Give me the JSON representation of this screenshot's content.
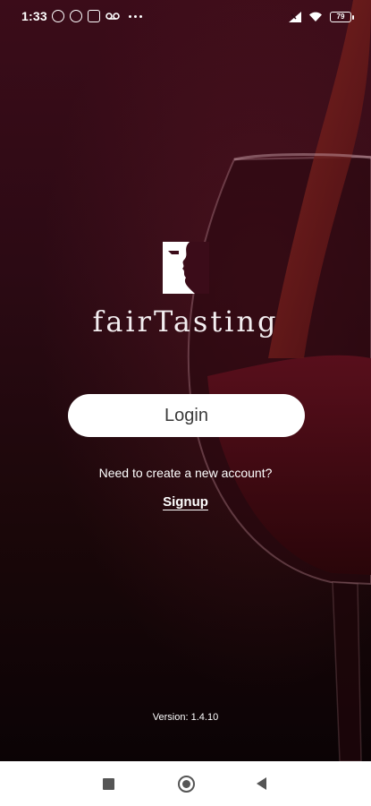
{
  "status_bar": {
    "time": "1:33",
    "battery": "79"
  },
  "brand": {
    "name": "fairTasting"
  },
  "login": {
    "label": "Login"
  },
  "signup": {
    "prompt": "Need to create a new account?",
    "link_label": "Signup"
  },
  "footer": {
    "version": "Version: 1.4.10"
  },
  "icons": {
    "status_left": [
      "notification-off-icon",
      "at-icon",
      "grid-icon",
      "voicemail-icon",
      "more-dots-icon"
    ],
    "status_right": [
      "signal-icon",
      "wifi-icon",
      "battery-icon"
    ],
    "nav": [
      "recent-apps-icon",
      "home-icon",
      "back-icon"
    ]
  },
  "colors": {
    "background_top": "#3b0c19",
    "background_bottom": "#0b0305",
    "button": "#ffffff",
    "text": "#ffffff"
  }
}
